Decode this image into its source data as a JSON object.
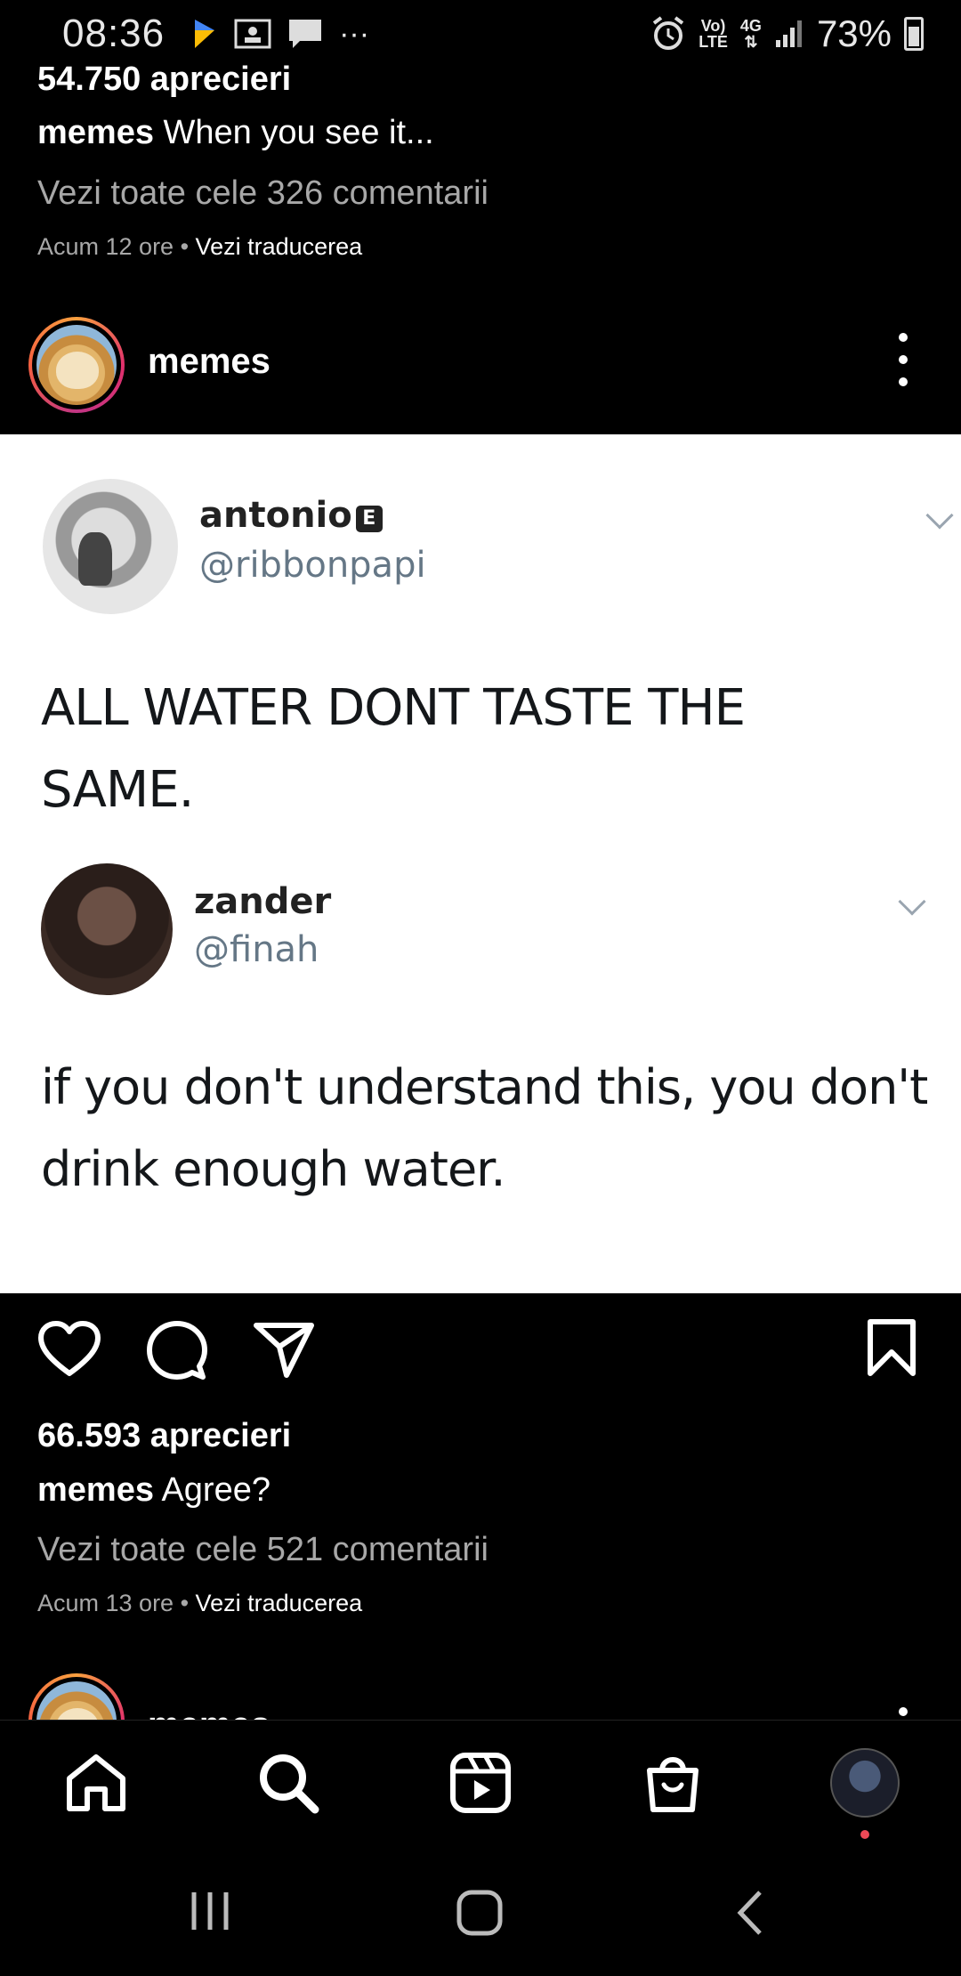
{
  "status_bar": {
    "time": "08:36",
    "overflow": "···",
    "volte": "Vo)",
    "lte": "LTE",
    "network": "4G",
    "battery": "73%"
  },
  "prev_post": {
    "likes": "54.750 aprecieri",
    "caption_user": "memes",
    "caption_text": "When you see it...",
    "comments_link": "Vezi toate cele 326 comentarii",
    "time": "Acum 12 ore",
    "separator": " • ",
    "translate": "Vezi traducerea"
  },
  "post": {
    "username": "memes",
    "tweet1": {
      "name": "antonio",
      "badge": "E",
      "handle": "@ribbonpapi",
      "text_line1": "ALL WATER DONT TASTE THE",
      "text_line2": "SAME."
    },
    "tweet2": {
      "name": "zander",
      "handle": "@finah",
      "text_line1": "if you don't understand this, you don't",
      "text_line2": "drink enough water."
    },
    "likes": "66.593 aprecieri",
    "caption_user": "memes",
    "caption_text": "Agree?",
    "comments_link": "Vezi toate cele 521 comentarii",
    "time": "Acum 13 ore",
    "separator": " • ",
    "translate": "Vezi traducerea"
  },
  "next_post": {
    "username": "memes"
  },
  "icons": {
    "like": "heart-icon",
    "comment": "comment-icon",
    "share": "send-icon",
    "save": "bookmark-icon",
    "home": "home-icon",
    "search": "search-icon",
    "reels": "reels-icon",
    "shop": "shop-icon",
    "profile": "profile-avatar"
  },
  "colors": {
    "background": "#000000",
    "secondary_text": "#a8a8a8",
    "notification_dot": "#ed4956"
  }
}
